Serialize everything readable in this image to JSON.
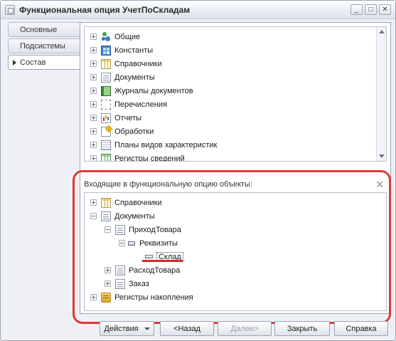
{
  "window": {
    "title": "Функциональная опция УчетПоСкладам",
    "controls": [
      "minimize",
      "maximize",
      "close"
    ]
  },
  "tabs": [
    {
      "label": "Основные",
      "active": false
    },
    {
      "label": "Подсистемы",
      "active": false
    },
    {
      "label": "Состав",
      "active": true
    }
  ],
  "top_tree": {
    "items": [
      {
        "label": "Общие",
        "icon": "common-icon"
      },
      {
        "label": "Константы",
        "icon": "constants-icon"
      },
      {
        "label": "Справочники",
        "icon": "catalogs-icon"
      },
      {
        "label": "Документы",
        "icon": "documents-icon"
      },
      {
        "label": "Журналы документов",
        "icon": "journals-icon"
      },
      {
        "label": "Перечисления",
        "icon": "enums-icon"
      },
      {
        "label": "Отчеты",
        "icon": "reports-icon"
      },
      {
        "label": "Обработки",
        "icon": "processing-icon"
      },
      {
        "label": "Планы видов характеристик",
        "icon": "char-plans-icon"
      },
      {
        "label": "Регистры сведений",
        "icon": "info-registers-icon"
      }
    ]
  },
  "bottom_section": {
    "header": "Входящие в функциональную опцию объекты:",
    "tree": {
      "catalogs": "Справочники",
      "documents": "Документы",
      "doc_receipt": "ПриходТовара",
      "requisites": "Реквизиты",
      "warehouse": "Склад",
      "doc_expense": "РасходТовара",
      "doc_order": "Заказ",
      "accum_registers": "Регистры накопления"
    }
  },
  "footer": {
    "actions": "Действия",
    "back": "<Назад",
    "next": "Далее>",
    "close": "Закрыть",
    "help": "Справка"
  }
}
